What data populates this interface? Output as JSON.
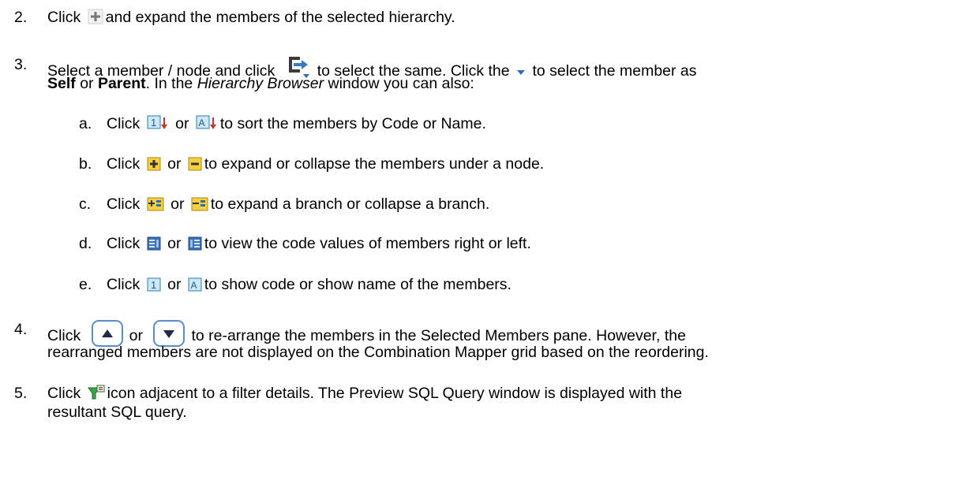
{
  "step2": {
    "num": "2.",
    "pre": "Click",
    "post": "and expand the members of the selected hierarchy.",
    "icon": "plus-icon"
  },
  "step3": {
    "num": "3.",
    "pre": "Select a member / node and click",
    "mid": "to select the same. Click the",
    "post": "to select the member as",
    "l2_self": "Self",
    "l2_or": "or",
    "l2_parent": "Parent",
    "l2_rest": ". In the",
    "l2_hb": "Hierarchy Browser",
    "l2_end": "window you can also:",
    "icons": [
      "select-member-icon",
      "dropdown-arrow-icon"
    ]
  },
  "sub": [
    {
      "letter": "a.",
      "click": "Click",
      "or": "or",
      "text": "to sort the members by Code or Name.",
      "icons": [
        "sort-by-code-icon",
        "sort-by-name-icon"
      ]
    },
    {
      "letter": "b.",
      "click": "Click",
      "or": "or",
      "text": "to expand or collapse the members under a node.",
      "icons": [
        "expand-node-icon",
        "collapse-node-icon"
      ]
    },
    {
      "letter": "c.",
      "click": "Click",
      "or": "or",
      "text": "to expand a branch or collapse a branch.",
      "icons": [
        "expand-branch-icon",
        "collapse-branch-icon"
      ]
    },
    {
      "letter": "d.",
      "click": "Click",
      "or": "or",
      "text": "to view the code values of members right or left.",
      "icons": [
        "code-right-icon",
        "code-left-icon"
      ]
    },
    {
      "letter": "e.",
      "click": "Click",
      "or": "or",
      "text": "to show code or show name of the members.",
      "icons": [
        "show-code-icon",
        "show-name-icon"
      ]
    }
  ],
  "step4": {
    "num": "4.",
    "pre": "Click",
    "or": "or",
    "line1": "to re-arrange the members in the Selected Members pane. However, the",
    "line2": "rearranged members are not displayed on the Combination Mapper grid based on the reordering.",
    "icons": [
      "move-up-icon",
      "move-down-icon"
    ]
  },
  "step5": {
    "num": "5.",
    "pre": "Click",
    "line1": "icon adjacent to a filter details. The Preview SQL Query window is displayed with the",
    "line2": "resultant SQL query.",
    "icon": "preview-sql-filter-icon"
  }
}
